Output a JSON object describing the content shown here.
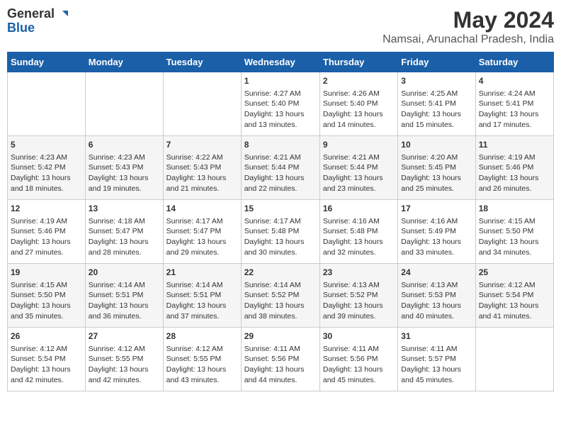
{
  "logo": {
    "line1": "General",
    "line2": "Blue"
  },
  "title": "May 2024",
  "subtitle": "Namsai, Arunachal Pradesh, India",
  "days_of_week": [
    "Sunday",
    "Monday",
    "Tuesday",
    "Wednesday",
    "Thursday",
    "Friday",
    "Saturday"
  ],
  "weeks": [
    [
      {
        "day": "",
        "info": ""
      },
      {
        "day": "",
        "info": ""
      },
      {
        "day": "",
        "info": ""
      },
      {
        "day": "1",
        "info": "Sunrise: 4:27 AM\nSunset: 5:40 PM\nDaylight: 13 hours\nand 13 minutes."
      },
      {
        "day": "2",
        "info": "Sunrise: 4:26 AM\nSunset: 5:40 PM\nDaylight: 13 hours\nand 14 minutes."
      },
      {
        "day": "3",
        "info": "Sunrise: 4:25 AM\nSunset: 5:41 PM\nDaylight: 13 hours\nand 15 minutes."
      },
      {
        "day": "4",
        "info": "Sunrise: 4:24 AM\nSunset: 5:41 PM\nDaylight: 13 hours\nand 17 minutes."
      }
    ],
    [
      {
        "day": "5",
        "info": "Sunrise: 4:23 AM\nSunset: 5:42 PM\nDaylight: 13 hours\nand 18 minutes."
      },
      {
        "day": "6",
        "info": "Sunrise: 4:23 AM\nSunset: 5:43 PM\nDaylight: 13 hours\nand 19 minutes."
      },
      {
        "day": "7",
        "info": "Sunrise: 4:22 AM\nSunset: 5:43 PM\nDaylight: 13 hours\nand 21 minutes."
      },
      {
        "day": "8",
        "info": "Sunrise: 4:21 AM\nSunset: 5:44 PM\nDaylight: 13 hours\nand 22 minutes."
      },
      {
        "day": "9",
        "info": "Sunrise: 4:21 AM\nSunset: 5:44 PM\nDaylight: 13 hours\nand 23 minutes."
      },
      {
        "day": "10",
        "info": "Sunrise: 4:20 AM\nSunset: 5:45 PM\nDaylight: 13 hours\nand 25 minutes."
      },
      {
        "day": "11",
        "info": "Sunrise: 4:19 AM\nSunset: 5:46 PM\nDaylight: 13 hours\nand 26 minutes."
      }
    ],
    [
      {
        "day": "12",
        "info": "Sunrise: 4:19 AM\nSunset: 5:46 PM\nDaylight: 13 hours\nand 27 minutes."
      },
      {
        "day": "13",
        "info": "Sunrise: 4:18 AM\nSunset: 5:47 PM\nDaylight: 13 hours\nand 28 minutes."
      },
      {
        "day": "14",
        "info": "Sunrise: 4:17 AM\nSunset: 5:47 PM\nDaylight: 13 hours\nand 29 minutes."
      },
      {
        "day": "15",
        "info": "Sunrise: 4:17 AM\nSunset: 5:48 PM\nDaylight: 13 hours\nand 30 minutes."
      },
      {
        "day": "16",
        "info": "Sunrise: 4:16 AM\nSunset: 5:48 PM\nDaylight: 13 hours\nand 32 minutes."
      },
      {
        "day": "17",
        "info": "Sunrise: 4:16 AM\nSunset: 5:49 PM\nDaylight: 13 hours\nand 33 minutes."
      },
      {
        "day": "18",
        "info": "Sunrise: 4:15 AM\nSunset: 5:50 PM\nDaylight: 13 hours\nand 34 minutes."
      }
    ],
    [
      {
        "day": "19",
        "info": "Sunrise: 4:15 AM\nSunset: 5:50 PM\nDaylight: 13 hours\nand 35 minutes."
      },
      {
        "day": "20",
        "info": "Sunrise: 4:14 AM\nSunset: 5:51 PM\nDaylight: 13 hours\nand 36 minutes."
      },
      {
        "day": "21",
        "info": "Sunrise: 4:14 AM\nSunset: 5:51 PM\nDaylight: 13 hours\nand 37 minutes."
      },
      {
        "day": "22",
        "info": "Sunrise: 4:14 AM\nSunset: 5:52 PM\nDaylight: 13 hours\nand 38 minutes."
      },
      {
        "day": "23",
        "info": "Sunrise: 4:13 AM\nSunset: 5:52 PM\nDaylight: 13 hours\nand 39 minutes."
      },
      {
        "day": "24",
        "info": "Sunrise: 4:13 AM\nSunset: 5:53 PM\nDaylight: 13 hours\nand 40 minutes."
      },
      {
        "day": "25",
        "info": "Sunrise: 4:12 AM\nSunset: 5:54 PM\nDaylight: 13 hours\nand 41 minutes."
      }
    ],
    [
      {
        "day": "26",
        "info": "Sunrise: 4:12 AM\nSunset: 5:54 PM\nDaylight: 13 hours\nand 42 minutes."
      },
      {
        "day": "27",
        "info": "Sunrise: 4:12 AM\nSunset: 5:55 PM\nDaylight: 13 hours\nand 42 minutes."
      },
      {
        "day": "28",
        "info": "Sunrise: 4:12 AM\nSunset: 5:55 PM\nDaylight: 13 hours\nand 43 minutes."
      },
      {
        "day": "29",
        "info": "Sunrise: 4:11 AM\nSunset: 5:56 PM\nDaylight: 13 hours\nand 44 minutes."
      },
      {
        "day": "30",
        "info": "Sunrise: 4:11 AM\nSunset: 5:56 PM\nDaylight: 13 hours\nand 45 minutes."
      },
      {
        "day": "31",
        "info": "Sunrise: 4:11 AM\nSunset: 5:57 PM\nDaylight: 13 hours\nand 45 minutes."
      },
      {
        "day": "",
        "info": ""
      }
    ]
  ]
}
